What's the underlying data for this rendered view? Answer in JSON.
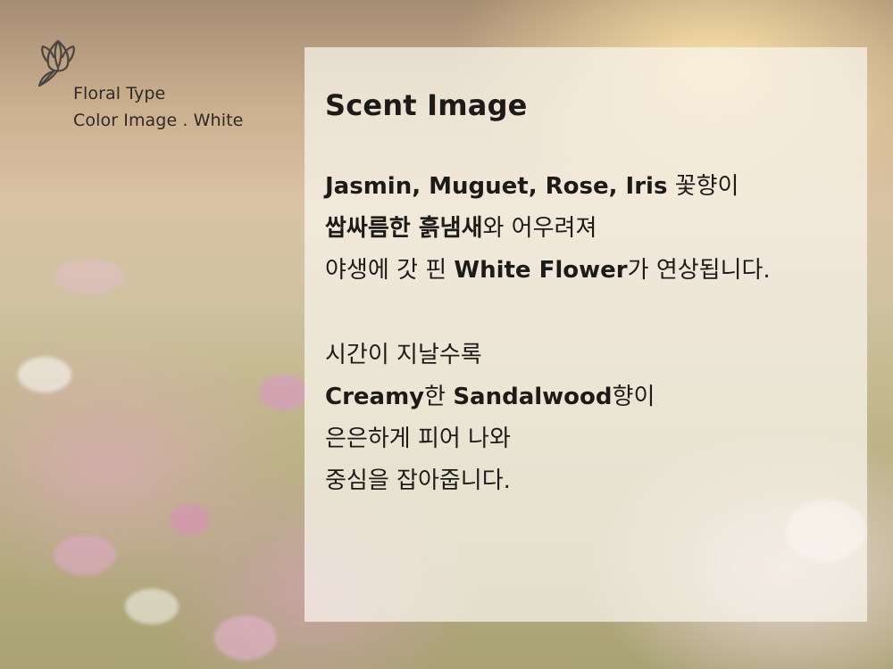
{
  "header": {
    "icon": "tulip-icon",
    "floral_type": "Floral Type",
    "color_image": "Color Image . White"
  },
  "panel": {
    "title": "Scent Image",
    "paragraph1": {
      "line1_bold": "Jasmin, Muguet, Rose, Iris",
      "line1_rest": " 꽃향이",
      "line2_bold": "쌉싸름한 흙냄새",
      "line2_rest": "와 어우려져",
      "line3_pre": "야생에 갓 핀 ",
      "line3_bold": "White Flower",
      "line3_rest": "가 연상됩니다."
    },
    "paragraph2": {
      "line1": "시간이 지날수록",
      "line2_bold1": "Creamy",
      "line2_mid": "한 ",
      "line2_bold2": "Sandalwood",
      "line2_rest": "향이",
      "line3": "은은하게 피어 나와",
      "line4": "중심을 잡아줍니다."
    }
  },
  "colors": {
    "panel_bg": "#f8f4ec",
    "text": "#1d1b18",
    "icon_stroke": "#4a4540"
  }
}
